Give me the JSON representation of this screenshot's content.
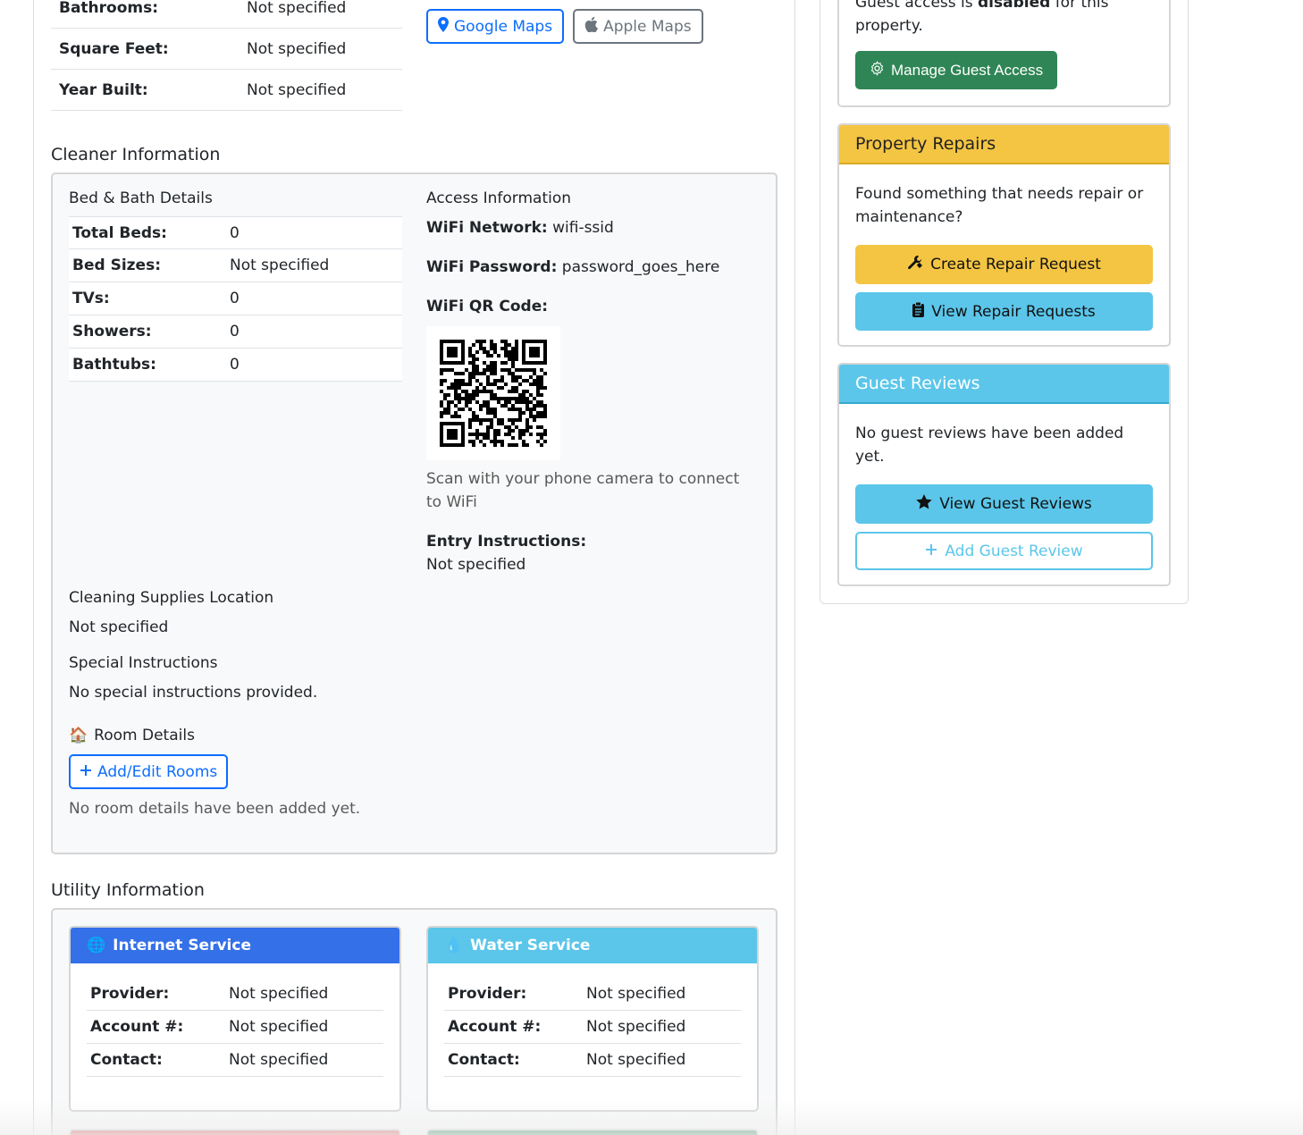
{
  "property_table": [
    {
      "label": "Bathrooms:",
      "value": "Not specified"
    },
    {
      "label": "Square Feet:",
      "value": "Not specified"
    },
    {
      "label": "Year Built:",
      "value": "Not specified"
    }
  ],
  "maps": {
    "google": "Google Maps",
    "apple": "Apple Maps"
  },
  "cleaner": {
    "title": "Cleaner Information",
    "bed_bath_title": "Bed & Bath Details",
    "bed_bath": [
      {
        "label": "Total Beds:",
        "value": "0"
      },
      {
        "label": "Bed Sizes:",
        "value": "Not specified"
      },
      {
        "label": "TVs:",
        "value": "0"
      },
      {
        "label": "Showers:",
        "value": "0"
      },
      {
        "label": "Bathtubs:",
        "value": "0"
      }
    ],
    "access_title": "Access Information",
    "wifi_network_label": "WiFi Network:",
    "wifi_network": "wifi-ssid",
    "wifi_password_label": "WiFi Password:",
    "wifi_password": "password_goes_here",
    "wifi_qr_label": "WiFi QR Code:",
    "qr_hint_1": "Scan with your phone camera to connect",
    "qr_hint_2": "to WiFi",
    "entry_label": "Entry Instructions:",
    "entry_value": "Not specified",
    "supplies_title": "Cleaning Supplies Location",
    "supplies_value": "Not specified",
    "special_title": "Special Instructions",
    "special_value": "No special instructions provided.",
    "room_title": "Room Details",
    "room_icon": "🏠",
    "room_button": "Add/Edit Rooms",
    "room_empty": "No room details have been added yet."
  },
  "utility": {
    "title": "Utility Information",
    "cards": [
      {
        "name": "Internet Service",
        "icon": "🌐",
        "color": "#3470e8",
        "rows": [
          {
            "label": "Provider:",
            "value": "Not specified"
          },
          {
            "label": "Account #:",
            "value": "Not specified"
          },
          {
            "label": "Contact:",
            "value": "Not specified"
          }
        ]
      },
      {
        "name": "Water Service",
        "icon": "💧",
        "color": "#5bc6ea",
        "rows": [
          {
            "label": "Provider:",
            "value": "Not specified"
          },
          {
            "label": "Account #:",
            "value": "Not specified"
          },
          {
            "label": "Contact:",
            "value": "Not specified"
          }
        ]
      }
    ]
  },
  "guest_access": {
    "text_pre": "Guest access is ",
    "text_bold": "disabled",
    "text_post": " for this",
    "text_line2": "property.",
    "button": "Manage Guest Access"
  },
  "repairs": {
    "title": "Property Repairs",
    "text_1": "Found something that needs repair or",
    "text_2": "maintenance?",
    "create_button": "Create Repair Request",
    "view_button": "View Repair Requests",
    "color": "#f4c542"
  },
  "reviews": {
    "title": "Guest Reviews",
    "text_1": "No guest reviews have been added",
    "text_2": "yet.",
    "view_button": "View Guest Reviews",
    "add_button": "Add Guest Review",
    "color": "#5bc6ea"
  }
}
